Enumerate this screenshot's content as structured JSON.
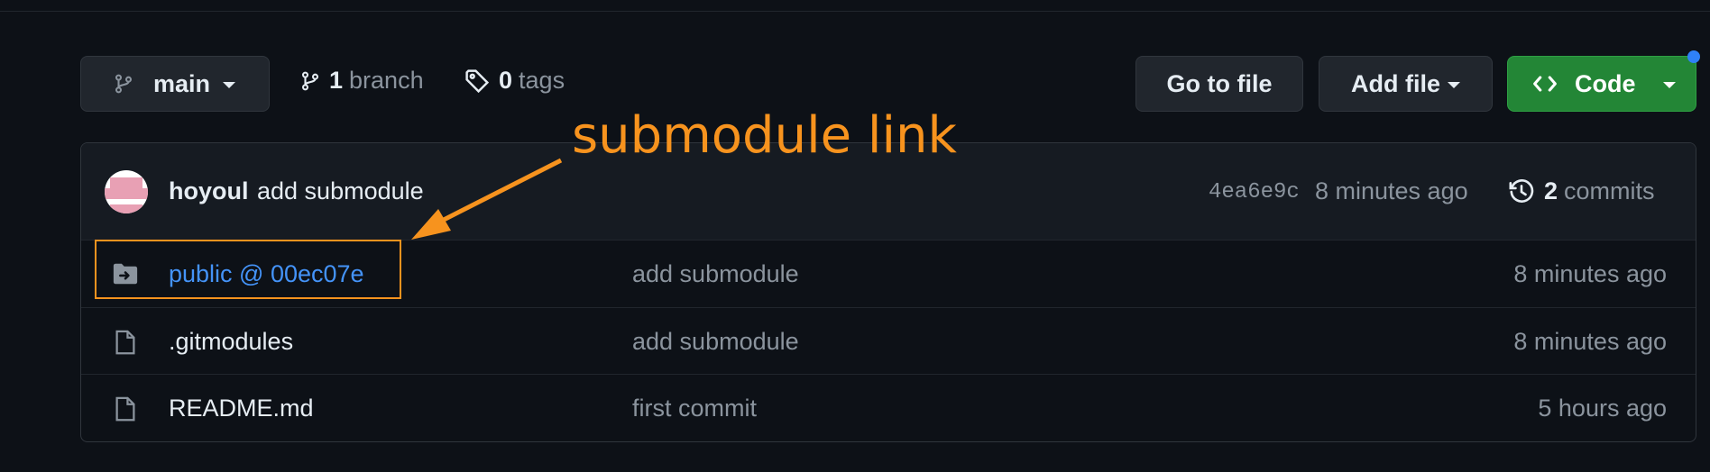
{
  "toolbar": {
    "branch_selector": "main",
    "branches_count": "1",
    "branches_label": "branch",
    "tags_count": "0",
    "tags_label": "tags",
    "goto_file": "Go to file",
    "add_file": "Add file",
    "code": "Code"
  },
  "latest_commit": {
    "author": "hoyoul",
    "message": "add submodule",
    "sha": "4ea6e9c",
    "time": "8 minutes ago",
    "commits_count": "2",
    "commits_label": "commits"
  },
  "files": [
    {
      "name": "public @ 00ec07e",
      "type": "submodule",
      "message": "add submodule",
      "time": "8 minutes ago"
    },
    {
      "name": ".gitmodules",
      "type": "file",
      "message": "add submodule",
      "time": "8 minutes ago"
    },
    {
      "name": "README.md",
      "type": "file",
      "message": "first commit",
      "time": "5 hours ago"
    }
  ],
  "annotation": {
    "label": "submodule link"
  },
  "colors": {
    "background": "#0d1117",
    "link_blue": "#4493f8",
    "code_green": "#238636",
    "annotation_orange": "#f7931e"
  },
  "icons": {
    "branch": "git-branch-icon",
    "tag": "tag-icon",
    "code": "code-icon",
    "history": "history-icon",
    "submodule": "file-submodule-icon",
    "file": "file-icon"
  }
}
